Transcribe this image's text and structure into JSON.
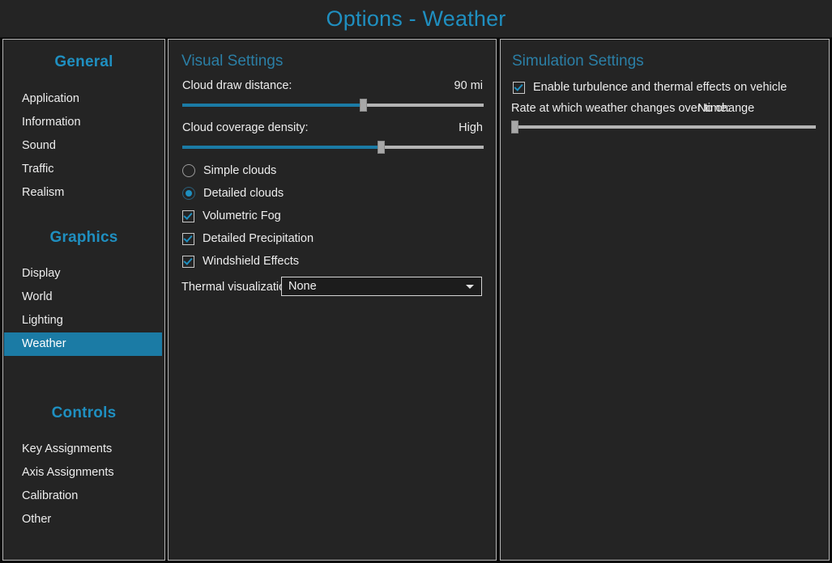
{
  "window": {
    "title": "Options - Weather"
  },
  "colors": {
    "accent": "#1f8fc0",
    "selection": "#1b7ba5",
    "panel_bg": "#242424",
    "panel_border": "#b6b6b6",
    "text": "#ededed",
    "slider_track": "#b4b4b4"
  },
  "sidebar": {
    "groups": [
      {
        "header": "General",
        "items": [
          {
            "label": "Application",
            "selected": false
          },
          {
            "label": "Information",
            "selected": false
          },
          {
            "label": "Sound",
            "selected": false
          },
          {
            "label": "Traffic",
            "selected": false
          },
          {
            "label": "Realism",
            "selected": false
          }
        ]
      },
      {
        "header": "Graphics",
        "items": [
          {
            "label": "Display",
            "selected": false
          },
          {
            "label": "World",
            "selected": false
          },
          {
            "label": "Lighting",
            "selected": false
          },
          {
            "label": "Weather",
            "selected": true
          }
        ]
      },
      {
        "header": "Controls",
        "items": [
          {
            "label": "Key Assignments",
            "selected": false
          },
          {
            "label": "Axis Assignments",
            "selected": false
          },
          {
            "label": "Calibration",
            "selected": false
          },
          {
            "label": "Other",
            "selected": false
          }
        ]
      }
    ]
  },
  "visual_settings": {
    "title": "Visual Settings",
    "cloud_draw_distance": {
      "label": "Cloud draw distance:",
      "value": "90 mi",
      "percent": 60
    },
    "cloud_coverage_density": {
      "label": "Cloud coverage density:",
      "value": "High",
      "percent": 66
    },
    "cloud_detail_options": [
      {
        "label": "Simple clouds",
        "checked": false
      },
      {
        "label": "Detailed clouds",
        "checked": true
      }
    ],
    "checkboxes": [
      {
        "label": "Volumetric Fog",
        "checked": true
      },
      {
        "label": "Detailed Precipitation",
        "checked": true
      },
      {
        "label": "Windshield Effects",
        "checked": true
      }
    ],
    "thermal_visualization": {
      "label": "Thermal visualization:",
      "value": "None",
      "arrow_icon": "chevron-down-icon"
    }
  },
  "simulation_settings": {
    "title": "Simulation Settings",
    "turbulence": {
      "label": "Enable turbulence and thermal effects on vehicle",
      "checked": true
    },
    "weather_change_rate": {
      "label": "Rate at which weather changes over time:",
      "value": "No change",
      "percent": 0
    }
  }
}
